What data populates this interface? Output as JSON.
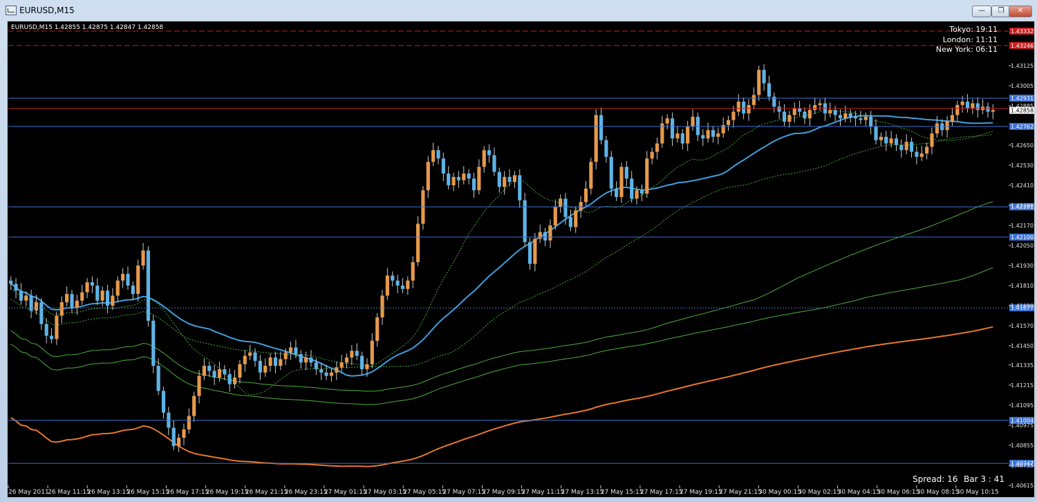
{
  "window": {
    "title": "EURUSD,M15",
    "minimize_icon": "minimize-icon",
    "restore_icon": "restore-icon",
    "close_icon": "close-icon"
  },
  "chart": {
    "header": "EURUSD,M15  1.42855 1.42875 1.42847 1.42858",
    "sessions": [
      "Tokyo: 19:11",
      "London: 11:11",
      "New York: 06:11"
    ],
    "footer": {
      "spread": "Spread: 16",
      "bar": "Bar  3 : 41"
    },
    "colors": {
      "bull": "#e69a4b",
      "bear": "#5eb3e6",
      "hline": "#3b73d6",
      "red_line": "#c81e1e",
      "ma_blue": "#3fa0e0",
      "ma_orange": "#e8772e",
      "ma_green": "#4caf3b",
      "price_label": "#ffffff"
    }
  },
  "chart_data": {
    "type": "candlestick",
    "symbol": "EURUSD",
    "timeframe": "M15",
    "ylim": [
      1.40615,
      1.43365
    ],
    "y_ticks": [
      "1.43125",
      "1.43005",
      "1.42885",
      "1.42650",
      "1.42530",
      "1.42410",
      "1.42290",
      "1.42170",
      "1.42050",
      "1.41930",
      "1.41810",
      "1.41690",
      "1.41570",
      "1.41450",
      "1.41335",
      "1.41215",
      "1.41095",
      "1.40975",
      "1.40855",
      "1.40735",
      "1.40615"
    ],
    "x_ticks": [
      "26 May 2011",
      "26 May 11:15",
      "26 May 13:15",
      "26 May 15:15",
      "26 May 17:15",
      "26 May 19:15",
      "26 May 21:15",
      "26 May 23:15",
      "27 May 01:15",
      "27 May 03:15",
      "27 May 05:15",
      "27 May 07:15",
      "27 May 09:15",
      "27 May 11:15",
      "27 May 13:15",
      "27 May 15:15",
      "27 May 17:15",
      "27 May 19:15",
      "27 May 21:15",
      "30 May 00:15",
      "30 May 02:15",
      "30 May 04:15",
      "30 May 06:15",
      "30 May 08:15",
      "30 May 10:15"
    ],
    "horizontal_levels": [
      {
        "price": 1.43332,
        "label": "1.43332",
        "color": "red",
        "style": "dashed"
      },
      {
        "price": 1.43246,
        "label": "1.43246",
        "color": "red",
        "style": "dashed"
      },
      {
        "price": 1.42931,
        "label": "1.42931",
        "color": "blue",
        "style": "solid"
      },
      {
        "price": 1.4287,
        "label": "",
        "color": "red",
        "style": "solid"
      },
      {
        "price": 1.42762,
        "label": "1.42762",
        "color": "blue",
        "style": "solid"
      },
      {
        "price": 1.42281,
        "label": "1.42281",
        "color": "blue",
        "style": "solid"
      },
      {
        "price": 1.421,
        "label": "1.42100",
        "color": "blue",
        "style": "solid"
      },
      {
        "price": 1.41677,
        "label": "1.41677",
        "color": "blue",
        "style": "dotted"
      },
      {
        "price": 1.41004,
        "label": "1.41004",
        "color": "blue",
        "style": "solid"
      },
      {
        "price": 1.40747,
        "label": "1.40747",
        "color": "blue",
        "style": "solid"
      }
    ],
    "current_price": {
      "price": 1.42858,
      "label": "1.42858"
    },
    "closes": [
      1.4182,
      1.4178,
      1.4172,
      1.4175,
      1.4166,
      1.4171,
      1.4158,
      1.4151,
      1.4149,
      1.4163,
      1.4171,
      1.4176,
      1.4168,
      1.4172,
      1.4177,
      1.4183,
      1.4181,
      1.4172,
      1.4178,
      1.4169,
      1.4175,
      1.4184,
      1.4188,
      1.4181,
      1.4176,
      1.4193,
      1.4202,
      1.416,
      1.4133,
      1.4118,
      1.4105,
      1.4096,
      1.4085,
      1.409,
      1.4095,
      1.4103,
      1.4115,
      1.4127,
      1.4133,
      1.413,
      1.4126,
      1.4131,
      1.4128,
      1.4122,
      1.4126,
      1.4134,
      1.4139,
      1.4141,
      1.4136,
      1.4129,
      1.4133,
      1.4138,
      1.4133,
      1.4137,
      1.4141,
      1.4144,
      1.414,
      1.4135,
      1.4138,
      1.4135,
      1.4131,
      1.4129,
      1.4127,
      1.4129,
      1.4132,
      1.4135,
      1.4138,
      1.4142,
      1.4139,
      1.4131,
      1.4134,
      1.4148,
      1.4162,
      1.4175,
      1.4187,
      1.4184,
      1.4181,
      1.4179,
      1.4184,
      1.4195,
      1.4218,
      1.4238,
      1.4255,
      1.4262,
      1.4257,
      1.4248,
      1.4241,
      1.4246,
      1.4244,
      1.4248,
      1.4245,
      1.4238,
      1.4252,
      1.4262,
      1.4259,
      1.4249,
      1.424,
      1.4246,
      1.4243,
      1.4247,
      1.4232,
      1.4207,
      1.4194,
      1.4209,
      1.4213,
      1.4208,
      1.4217,
      1.4228,
      1.4233,
      1.4222,
      1.4216,
      1.4226,
      1.4231,
      1.4239,
      1.4255,
      1.4283,
      1.4268,
      1.4258,
      1.4239,
      1.4234,
      1.4252,
      1.4245,
      1.4233,
      1.4238,
      1.4236,
      1.4257,
      1.4261,
      1.4266,
      1.4278,
      1.4281,
      1.4269,
      1.4272,
      1.4266,
      1.4276,
      1.4282,
      1.4271,
      1.4269,
      1.4274,
      1.427,
      1.4272,
      1.4277,
      1.428,
      1.4285,
      1.4291,
      1.4284,
      1.4289,
      1.4295,
      1.431,
      1.4302,
      1.4294,
      1.4288,
      1.4285,
      1.4279,
      1.4283,
      1.4287,
      1.4285,
      1.4281,
      1.4286,
      1.4289,
      1.429,
      1.4284,
      1.4286,
      1.4283,
      1.4281,
      1.4284,
      1.4282,
      1.4281,
      1.428,
      1.4282,
      1.4276,
      1.4268,
      1.427,
      1.4266,
      1.4269,
      1.4265,
      1.4262,
      1.4267,
      1.4261,
      1.4258,
      1.426,
      1.4264,
      1.4272,
      1.4278,
      1.4274,
      1.4279,
      1.4283,
      1.4289,
      1.4291,
      1.4287,
      1.429,
      1.4286,
      1.4288,
      1.4285,
      1.4286
    ]
  }
}
